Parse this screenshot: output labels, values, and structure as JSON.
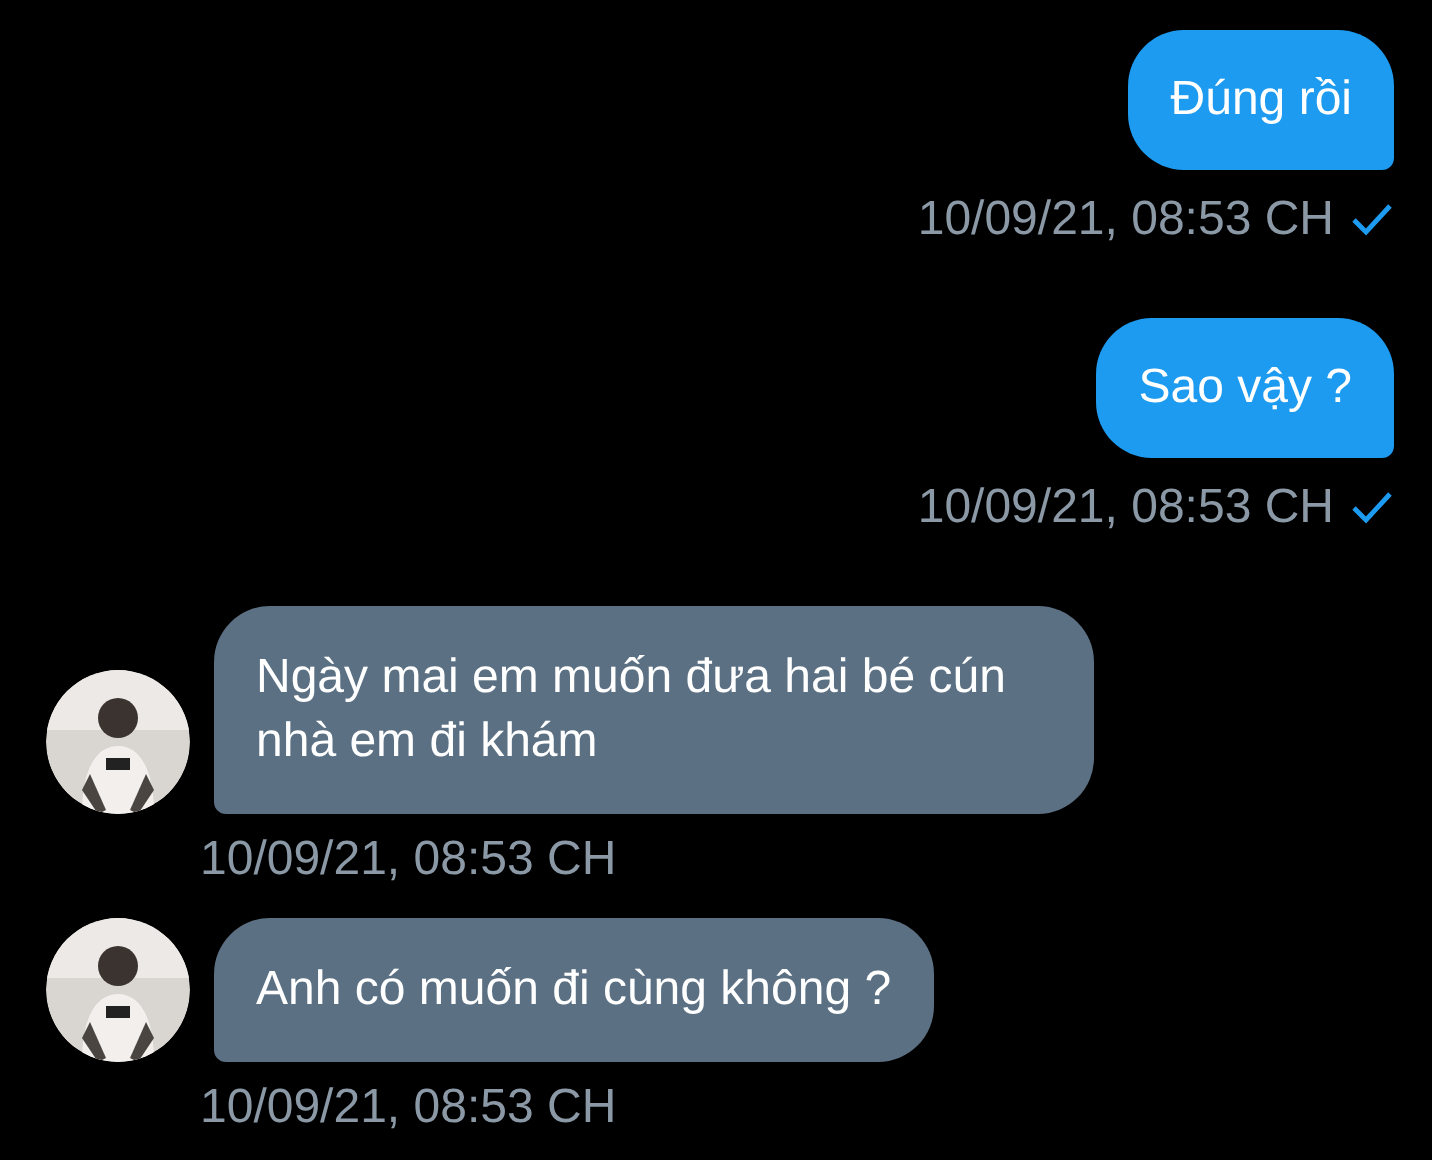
{
  "messages": [
    {
      "kind": "sent",
      "text": "Đúng rồi",
      "time": "10/09/21, 08:53 CH",
      "read": true
    },
    {
      "kind": "sent",
      "text": "Sao vậy ?",
      "time": "10/09/21, 08:53 CH",
      "read": true
    },
    {
      "kind": "received",
      "text": "Ngày mai em muốn đưa hai bé cún nhà em đi khám",
      "time": "10/09/21, 08:53 CH"
    },
    {
      "kind": "received",
      "text": "Anh có muốn đi cùng không ?",
      "time": "10/09/21, 08:53 CH"
    }
  ]
}
